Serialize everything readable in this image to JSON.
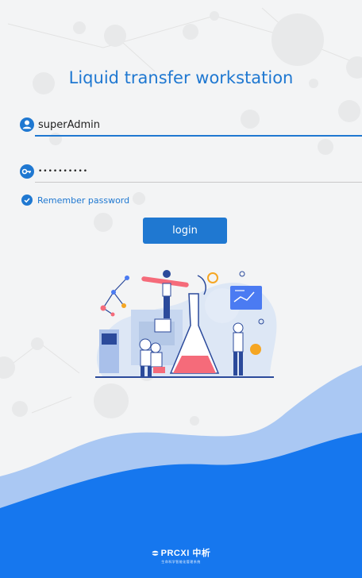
{
  "app": {
    "title": "Liquid transfer workstation"
  },
  "login_form": {
    "username_value": "superAdmin",
    "password_value": "••••••••••",
    "remember_label": "Remember password",
    "login_button_label": "login"
  },
  "brand": {
    "name": "PRCXI 中析",
    "tagline": "生命科学智能化管理系统"
  },
  "colors": {
    "accent": "#1f78d1",
    "wave_blue": "#1677ee",
    "wave_light": "#aac8f3",
    "background": "#f3f4f5"
  },
  "icons": {
    "username": "user-icon",
    "password": "key-icon",
    "remember": "check-icon",
    "logo": "prcxi-logo-icon"
  }
}
